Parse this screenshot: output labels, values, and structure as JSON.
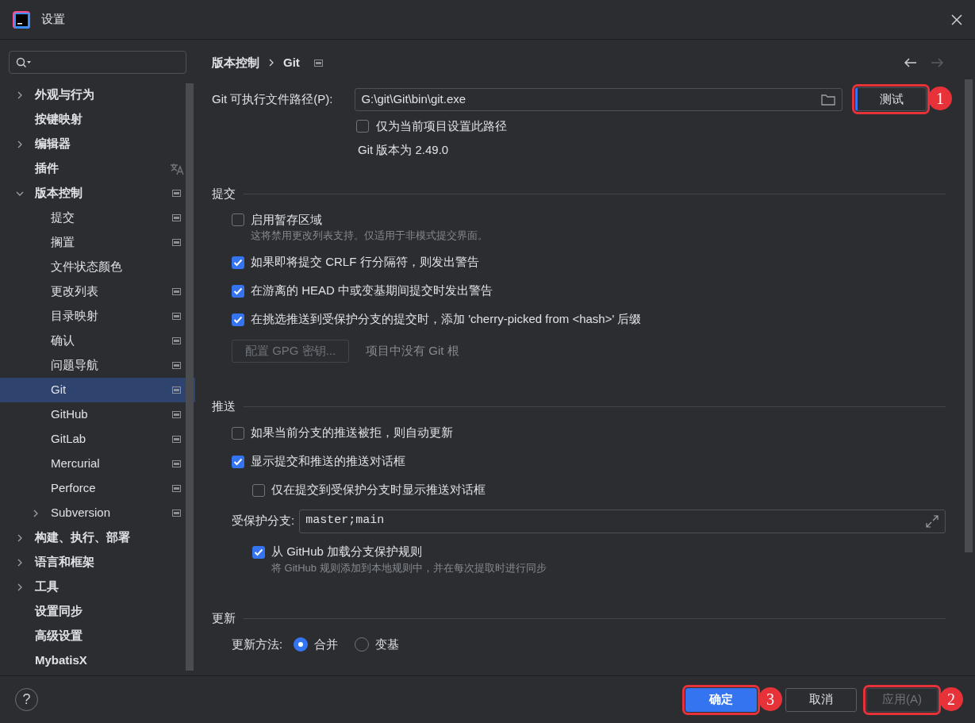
{
  "window": {
    "title": "设置"
  },
  "sidebar": {
    "items": [
      {
        "label": "外观与行为",
        "selected": false,
        "expanded": false
      },
      {
        "label": "按键映射",
        "selected": false
      },
      {
        "label": "编辑器",
        "selected": false,
        "expanded": false
      },
      {
        "label": "插件",
        "selected": false,
        "kind": "translatable"
      },
      {
        "label": "版本控制",
        "selected": false,
        "expanded": true,
        "kind": "project",
        "children": [
          {
            "label": "提交",
            "selected": false,
            "kind": "project"
          },
          {
            "label": "搁置",
            "selected": false,
            "kind": "project"
          },
          {
            "label": "文件状态颜色",
            "selected": false
          },
          {
            "label": "更改列表",
            "selected": false,
            "kind": "project"
          },
          {
            "label": "目录映射",
            "selected": false,
            "kind": "project"
          },
          {
            "label": "确认",
            "selected": false,
            "kind": "project"
          },
          {
            "label": "问题导航",
            "selected": false,
            "kind": "project"
          },
          {
            "label": "Git",
            "selected": true,
            "kind": "project"
          },
          {
            "label": "GitHub",
            "selected": false,
            "kind": "project"
          },
          {
            "label": "GitLab",
            "selected": false,
            "kind": "project"
          },
          {
            "label": "Mercurial",
            "selected": false,
            "kind": "project"
          },
          {
            "label": "Perforce",
            "selected": false,
            "kind": "project"
          },
          {
            "label": "Subversion",
            "selected": false,
            "expanded": false,
            "kind": "project"
          }
        ]
      },
      {
        "label": "构建、执行、部署",
        "selected": false,
        "expanded": false
      },
      {
        "label": "语言和框架",
        "selected": false,
        "expanded": false
      },
      {
        "label": "工具",
        "selected": false,
        "expanded": false
      },
      {
        "label": "设置同步",
        "selected": false
      },
      {
        "label": "高级设置",
        "selected": false
      },
      {
        "label": "MybatisX",
        "selected": false
      }
    ]
  },
  "breadcrumb": [
    "版本控制",
    "Git"
  ],
  "git_path": {
    "label": "Git 可执行文件路径(P):",
    "value": "G:\\git\\Git\\bin\\git.exe",
    "test_button": {
      "label": "测试",
      "callout": "1"
    }
  },
  "project_only": {
    "label": "仅为当前项目设置此路径",
    "checked": false
  },
  "version": "Git 版本为 2.49.0",
  "sections": [
    {
      "title": "提交",
      "rows": [
        {
          "kind": "checkbox",
          "label": "启用暂存区域",
          "checked": false,
          "hint": "这将禁用更改列表支持。仅适用于非模式提交界面。"
        },
        {
          "kind": "checkbox",
          "label": "如果即将提交 CRLF 行分隔符，则发出警告",
          "checked": true
        },
        {
          "kind": "checkbox",
          "label": "在游离的 HEAD 中或变基期间提交时发出警告",
          "checked": true
        },
        {
          "kind": "checkbox",
          "label": "在挑选推送到受保护分支的提交时，添加 'cherry-picked from <hash>' 后缀",
          "checked": true
        },
        {
          "kind": "button",
          "label": "配置 GPG 密钥...",
          "disabled": true,
          "note": "项目中没有 Git 根"
        }
      ]
    },
    {
      "title": "推送",
      "rows": [
        {
          "kind": "checkbox",
          "label": "如果当前分支的推送被拒，则自动更新",
          "checked": false
        },
        {
          "kind": "checkbox",
          "label": "显示提交和推送的推送对话框",
          "checked": true,
          "children": [
            {
              "kind": "checkbox",
              "label": "仅在提交到受保护分支时显示推送对话框",
              "checked": false
            }
          ]
        },
        {
          "kind": "field",
          "label": "受保护分支:",
          "value": "master;main",
          "children": [
            {
              "kind": "checkbox",
              "label": "从 GitHub 加载分支保护规则",
              "checked": true,
              "hint": "将 GitHub 规则添加到本地规则中，并在每次提取时进行同步"
            }
          ]
        }
      ]
    },
    {
      "title": "更新",
      "rows": [
        {
          "kind": "radio",
          "label": "更新方法:",
          "options": [
            {
              "label": "合并",
              "selected": true
            },
            {
              "label": "变基",
              "selected": false
            }
          ]
        }
      ]
    }
  ],
  "footer": {
    "help": "?",
    "buttons": [
      {
        "label": "确定",
        "kind": "primary",
        "callout": "3"
      },
      {
        "label": "取消",
        "kind": "secondary"
      },
      {
        "label": "应用(A)",
        "kind": "secondary",
        "disabled": true,
        "callout": "2"
      }
    ]
  }
}
